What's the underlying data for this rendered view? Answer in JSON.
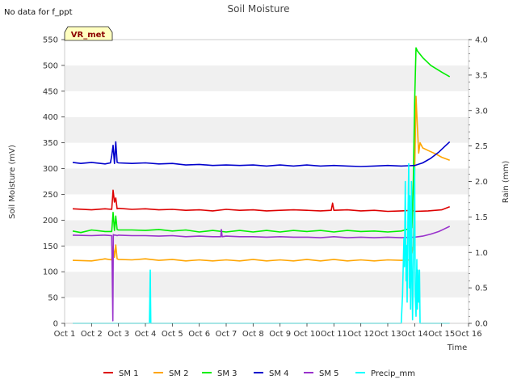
{
  "chart_data": {
    "type": "line",
    "title": "Soil Moisture",
    "note": "No data for f_ppt",
    "station_label": "VR_met",
    "xlabel": "Time",
    "ylabel": "Soil Moisture (mV)",
    "y2label": "Rain (mm)",
    "xlim": [
      1,
      16
    ],
    "ylim": [
      0,
      550
    ],
    "y2lim": [
      0,
      4.0
    ],
    "x_ticks": [
      1,
      2,
      3,
      4,
      5,
      6,
      7,
      8,
      9,
      10,
      11,
      12,
      13,
      14,
      15,
      16
    ],
    "x_tick_labels": [
      "Oct 1",
      "Oct 2",
      "Oct 3",
      "Oct 4",
      "Oct 5",
      "Oct 6",
      "Oct 7",
      "Oct 8",
      "Oct 9",
      "Oct 10",
      "Oct 11",
      "Oct 12",
      "Oct 13",
      "Oct 14",
      "Oct 15",
      "Oct 16"
    ],
    "y_ticks": [
      0,
      50,
      100,
      150,
      200,
      250,
      300,
      350,
      400,
      450,
      500,
      550
    ],
    "y2_ticks": [
      "0.0",
      "0.5",
      "1.0",
      "1.5",
      "2.0",
      "2.5",
      "3.0",
      "3.5",
      "4.0"
    ],
    "grid": "horizontal bands",
    "legend_position": "bottom",
    "series": [
      {
        "name": "SM 1",
        "color": "#dd0000",
        "axis": "left",
        "x": [
          1.3,
          2.0,
          2.5,
          2.75,
          2.8,
          2.85,
          2.9,
          2.95,
          3.0,
          3.5,
          4.0,
          4.5,
          5.0,
          5.5,
          6.0,
          6.5,
          7.0,
          7.5,
          8.0,
          8.5,
          9.0,
          9.5,
          10.0,
          10.5,
          10.9,
          10.95,
          11.0,
          11.5,
          12.0,
          12.5,
          13.0,
          13.5,
          13.9,
          14.0,
          14.5,
          15.0,
          15.3
        ],
        "y": [
          222,
          220,
          222,
          221,
          258,
          235,
          243,
          222,
          223,
          221,
          222,
          220,
          221,
          219,
          220,
          218,
          221,
          219,
          220,
          218,
          219,
          220,
          219,
          218,
          219,
          233,
          219,
          220,
          218,
          219,
          217,
          218,
          219,
          217,
          218,
          220,
          226
        ]
      },
      {
        "name": "SM 2",
        "color": "#ffa500",
        "axis": "left",
        "x": [
          1.3,
          2.0,
          2.5,
          2.75,
          2.8,
          2.85,
          2.9,
          2.95,
          3.0,
          3.5,
          4.0,
          4.5,
          5.0,
          5.5,
          6.0,
          6.5,
          7.0,
          7.5,
          8.0,
          8.5,
          9.0,
          9.5,
          10.0,
          10.5,
          11.0,
          11.5,
          12.0,
          12.5,
          13.0,
          13.5,
          13.85,
          13.95,
          14.05,
          14.1,
          14.15,
          14.2,
          14.3,
          14.5,
          14.8,
          15.0,
          15.3
        ],
        "y": [
          122,
          121,
          125,
          123,
          150,
          128,
          152,
          125,
          124,
          123,
          125,
          122,
          124,
          121,
          123,
          121,
          123,
          121,
          124,
          121,
          123,
          121,
          124,
          121,
          124,
          121,
          123,
          121,
          123,
          122,
          123,
          150,
          440,
          380,
          330,
          350,
          340,
          335,
          328,
          322,
          316
        ]
      },
      {
        "name": "SM 3",
        "color": "#00ee00",
        "axis": "left",
        "x": [
          1.3,
          1.6,
          2.0,
          2.5,
          2.75,
          2.8,
          2.85,
          2.9,
          2.95,
          3.0,
          3.5,
          4.0,
          4.5,
          5.0,
          5.5,
          6.0,
          6.5,
          7.0,
          7.5,
          8.0,
          8.5,
          9.0,
          9.5,
          10.0,
          10.5,
          11.0,
          11.5,
          12.0,
          12.5,
          13.0,
          13.5,
          13.9,
          13.95,
          14.0,
          14.05,
          14.1,
          14.3,
          14.6,
          15.0,
          15.3
        ],
        "y": [
          179,
          176,
          181,
          178,
          178,
          215,
          180,
          208,
          182,
          181,
          181,
          180,
          182,
          179,
          181,
          177,
          180,
          177,
          180,
          177,
          180,
          177,
          180,
          178,
          180,
          177,
          180,
          178,
          179,
          177,
          179,
          185,
          280,
          430,
          534,
          528,
          515,
          500,
          487,
          478
        ]
      },
      {
        "name": "SM 4",
        "color": "#0000cc",
        "axis": "left",
        "x": [
          1.3,
          1.6,
          2.0,
          2.5,
          2.7,
          2.75,
          2.8,
          2.85,
          2.9,
          2.95,
          3.0,
          3.5,
          4.0,
          4.5,
          5.0,
          5.5,
          6.0,
          6.5,
          7.0,
          7.5,
          8.0,
          8.5,
          9.0,
          9.5,
          10.0,
          10.5,
          11.0,
          11.5,
          12.0,
          12.5,
          13.0,
          13.5,
          14.0,
          14.3,
          14.6,
          14.9,
          15.1,
          15.3
        ],
        "y": [
          312,
          310,
          312,
          309,
          311,
          325,
          345,
          310,
          352,
          312,
          311,
          310,
          311,
          309,
          310,
          307,
          308,
          306,
          307,
          306,
          307,
          305,
          307,
          305,
          307,
          305,
          306,
          305,
          304,
          305,
          306,
          305,
          306,
          311,
          320,
          332,
          342,
          352
        ]
      },
      {
        "name": "SM 5",
        "color": "#9932cc",
        "axis": "left",
        "x": [
          1.3,
          2.0,
          2.5,
          2.75,
          2.79,
          2.81,
          2.85,
          2.9,
          2.95,
          3.0,
          3.5,
          4.0,
          4.5,
          5.0,
          5.5,
          6.0,
          6.5,
          6.8,
          6.82,
          6.85,
          7.0,
          7.5,
          8.0,
          8.5,
          9.0,
          9.5,
          10.0,
          10.5,
          11.0,
          11.5,
          12.0,
          12.5,
          13.0,
          13.5,
          14.0,
          14.3,
          14.6,
          14.9,
          15.1,
          15.3
        ],
        "y": [
          171,
          170,
          171,
          170,
          5,
          172,
          171,
          171,
          170,
          171,
          170,
          170,
          169,
          170,
          168,
          169,
          168,
          168,
          182,
          168,
          169,
          168,
          168,
          167,
          168,
          167,
          167,
          166,
          168,
          166,
          167,
          166,
          167,
          166,
          167,
          169,
          173,
          178,
          183,
          188
        ]
      },
      {
        "name": "Precip_mm",
        "color": "#00ffff",
        "axis": "right",
        "x": [
          1.3,
          4.15,
          4.18,
          4.2,
          4.23,
          13.5,
          13.55,
          13.6,
          13.62,
          13.65,
          13.68,
          13.7,
          13.72,
          13.75,
          13.78,
          13.8,
          13.82,
          13.85,
          13.88,
          13.9,
          13.92,
          13.95,
          13.98,
          14.0,
          14.02,
          14.05,
          14.08,
          14.1,
          14.12,
          14.15,
          14.18,
          14.2,
          14.25,
          15.3
        ],
        "y": [
          0,
          0,
          0.75,
          0,
          0,
          0,
          0.4,
          1.2,
          0.8,
          2.0,
          0.6,
          1.1,
          0.3,
          1.5,
          2.25,
          0.5,
          1.8,
          0.2,
          2.0,
          0.7,
          0.05,
          0.8,
          1.6,
          2.2,
          0.4,
          0.1,
          0.9,
          0.2,
          0.75,
          0.3,
          0.75,
          0,
          0,
          0
        ]
      }
    ]
  }
}
